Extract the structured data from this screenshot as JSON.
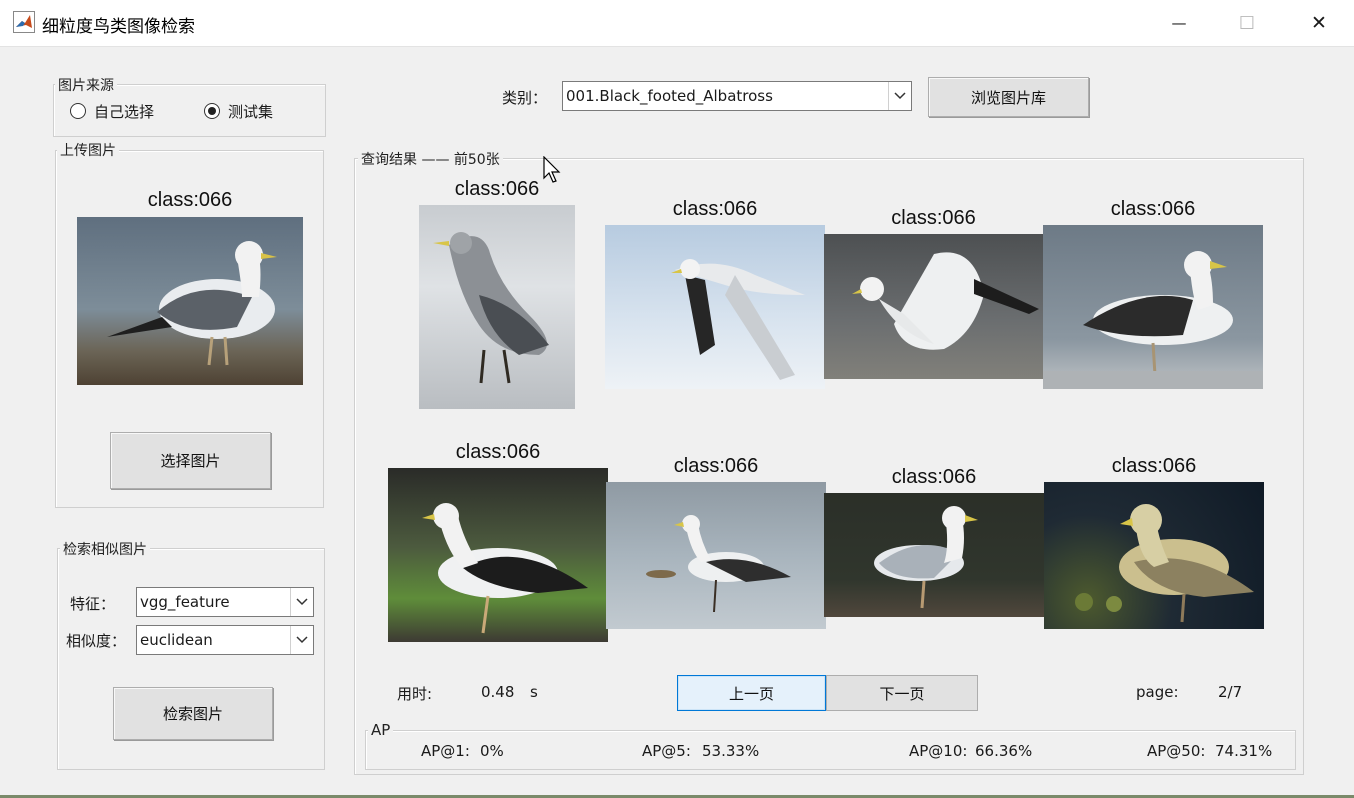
{
  "window": {
    "title": "细粒度鸟类图像检索",
    "minimize_glyph": "—",
    "maximize_glyph": "☐",
    "close_glyph": "✕",
    "icon": "matlab-logo-icon"
  },
  "source_panel": {
    "title": "图片来源",
    "option_self": "自己选择",
    "option_test": "测试集",
    "selected": "测试集"
  },
  "upload_panel": {
    "title": "上传图片",
    "image_label": "class:066",
    "select_button": "选择图片"
  },
  "search_panel": {
    "title": "检索相似图片",
    "feature_label": "特征：",
    "feature_value": "vgg_feature",
    "similarity_label": "相似度：",
    "similarity_value": "euclidean",
    "search_button": "检索图片"
  },
  "category": {
    "label": "类别：",
    "value": "001.Black_footed_Albatross",
    "browse_button": "浏览图片库"
  },
  "results": {
    "title": "查询结果 —— 前50张",
    "items": [
      {
        "label": "class:066"
      },
      {
        "label": "class:066"
      },
      {
        "label": "class:066"
      },
      {
        "label": "class:066"
      },
      {
        "label": "class:066"
      },
      {
        "label": "class:066"
      },
      {
        "label": "class:066"
      },
      {
        "label": "class:066"
      }
    ],
    "time_label": "用时:",
    "time_value": "0.48",
    "time_unit": "s",
    "prev_button": "上一页",
    "next_button": "下一页",
    "page_label": "page:",
    "page_value": "2/7"
  },
  "ap": {
    "title": "AP",
    "ap1_label": "AP@1:",
    "ap1_value": "0%",
    "ap5_label": "AP@5:",
    "ap5_value": "53.33%",
    "ap10_label": "AP@10:",
    "ap10_value": "66.36%",
    "ap50_label": "AP@50:",
    "ap50_value": "74.31%"
  },
  "colors": {
    "window_bg": "#f0f0f0",
    "titlebar_bg": "#ffffff",
    "active_button": "#e5f1fb",
    "active_border": "#0078d7"
  }
}
